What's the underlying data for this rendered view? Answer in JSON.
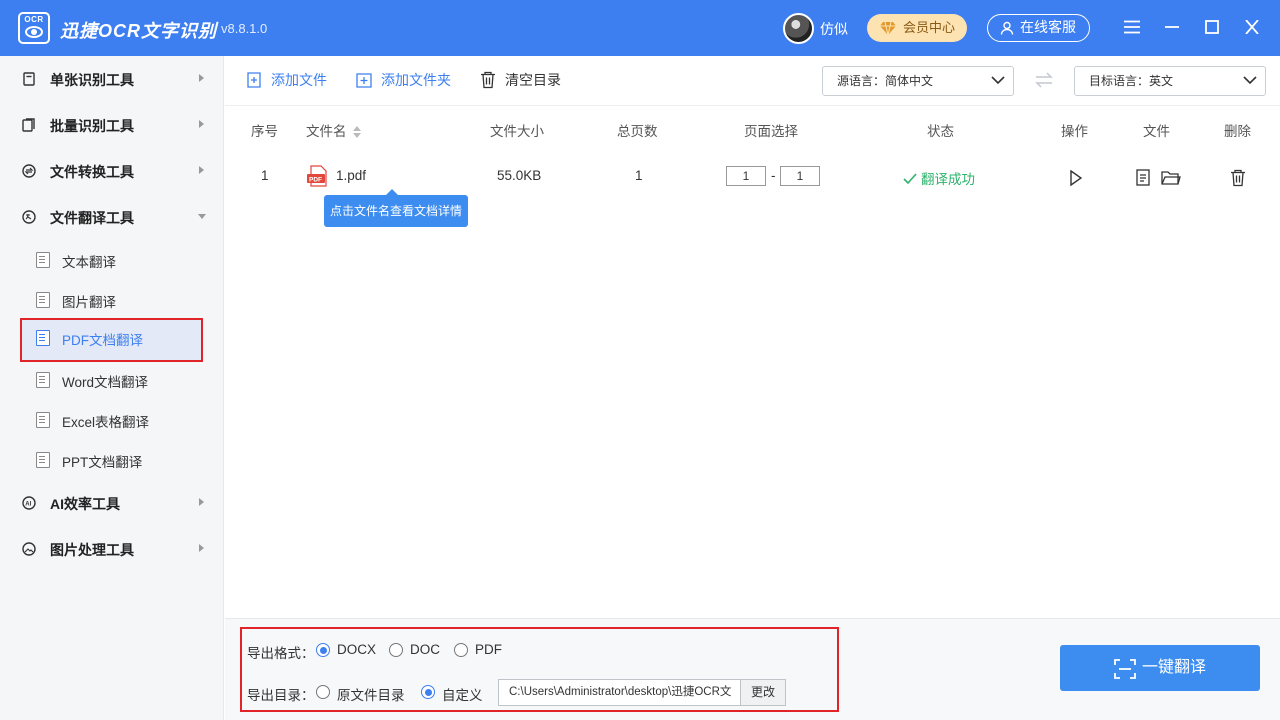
{
  "titlebar": {
    "logo_text": "OCR",
    "app_name": "迅捷OCR文字识别",
    "version": "v8.8.1.0",
    "username": "仿似",
    "vip_label": "会员中心",
    "service_label": "在线客服"
  },
  "sidebar": {
    "groups": [
      {
        "label": "单张识别工具",
        "icon": "single-doc-icon"
      },
      {
        "label": "批量识别工具",
        "icon": "batch-doc-icon"
      },
      {
        "label": "文件转换工具",
        "icon": "convert-icon"
      },
      {
        "label": "文件翻译工具",
        "icon": "translate-icon",
        "expanded": true
      },
      {
        "label": "AI效率工具",
        "icon": "ai-icon"
      },
      {
        "label": "图片处理工具",
        "icon": "image-icon"
      }
    ],
    "items": [
      {
        "label": "文本翻译"
      },
      {
        "label": "图片翻译"
      },
      {
        "label": "PDF文档翻译",
        "active": true
      },
      {
        "label": "Word文档翻译"
      },
      {
        "label": "Excel表格翻译"
      },
      {
        "label": "PPT文档翻译"
      }
    ]
  },
  "toolbar": {
    "add_file": "添加文件",
    "add_folder": "添加文件夹",
    "clear": "清空目录",
    "source_lang": "源语言：简体中文",
    "target_lang": "目标语言：英文"
  },
  "table": {
    "headers": {
      "index": "序号",
      "filename": "文件名",
      "size": "文件大小",
      "pages": "总页数",
      "page_select": "页面选择",
      "status": "状态",
      "action": "操作",
      "file": "文件",
      "delete": "删除"
    },
    "rows": [
      {
        "index": "1",
        "filename": "1.pdf",
        "size": "55.0KB",
        "pages": "1",
        "page_from": "1",
        "page_to": "1",
        "page_sep": "-",
        "status": "翻译成功"
      }
    ],
    "file_icon_text": "PDF",
    "tooltip": "点击文件名查看文档详情"
  },
  "options": {
    "format_label": "导出格式：",
    "formats": [
      {
        "label": "DOCX",
        "selected": true
      },
      {
        "label": "DOC",
        "selected": false
      },
      {
        "label": "PDF",
        "selected": false
      }
    ],
    "dir_label": "导出目录：",
    "dirs": [
      {
        "label": "原文件目录",
        "selected": false
      },
      {
        "label": "自定义",
        "selected": true
      }
    ],
    "path": "C:\\Users\\Administrator\\desktop\\迅捷OCR文",
    "change_label": "更改"
  },
  "translate_button": "一键翻译",
  "colors": {
    "accent": "#3d7ff1",
    "success": "#2bb36b",
    "highlight_border": "#e0242a"
  }
}
